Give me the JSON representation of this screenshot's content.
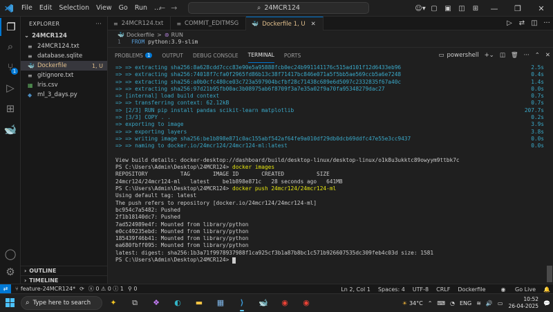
{
  "titlebar": {
    "menus": [
      "File",
      "Edit",
      "Selection",
      "View",
      "Go",
      "Run",
      "..."
    ],
    "search": "24MCR124"
  },
  "explorer": {
    "header": "EXPLORER",
    "folder": "24MCR124",
    "files": [
      {
        "name": "24MCR124.txt",
        "icon": "≡",
        "status": ""
      },
      {
        "name": "database.sqlite",
        "icon": "≡",
        "status": ""
      },
      {
        "name": "Dockerfile",
        "icon": "🐳",
        "status": "1, U"
      },
      {
        "name": "gitignore.txt",
        "icon": "≡",
        "status": ""
      },
      {
        "name": "Iris.csv",
        "icon": "▦",
        "status": ""
      },
      {
        "name": "ml_3_days.py",
        "icon": "◆",
        "status": ""
      }
    ],
    "outline": "OUTLINE",
    "timeline": "TIMELINE"
  },
  "tabs": [
    {
      "label": "24MCR124.txt",
      "icon": "≡"
    },
    {
      "label": "COMMIT_EDITMSG",
      "icon": "≡"
    },
    {
      "label": "Dockerfile 1, U",
      "icon": "🐳"
    }
  ],
  "breadcrumb": {
    "file": "Dockerfile",
    "sep": ">",
    "symbol": "RUN"
  },
  "code": {
    "line_no": "1",
    "keyword": "FROM",
    "text": "python:3.9-slim"
  },
  "panel": {
    "tabs": [
      "PROBLEMS",
      "OUTPUT",
      "DEBUG CONSOLE",
      "TERMINAL",
      "PORTS"
    ],
    "problems_count": "1",
    "shell": "powershell"
  },
  "terminal": {
    "lines": [
      {
        "text": "=> => extracting sha256:8a628cdd7ccc83e90e5a95888fcb0ec24b991141176c515ad101f12d6433eb96",
        "time": "2.5s",
        "blue": true
      },
      {
        "text": "=> => extracting sha256:74018f7cfa0f2965fd86b13c38f71417bc846e071a5f5bb5ae569ccb5a6e7248",
        "time": "0.4s",
        "blue": true
      },
      {
        "text": "=> => extracting sha256:a0b0cfc480ce03c723a597904bcfbf28c71438c689e6d5097c2332835f67a40c",
        "time": "1.4s",
        "blue": true
      },
      {
        "text": "=> => extracting sha256:97d21b95fb00ac3b08975ab6f8709f3a7e35a02f9a70fa95348279dac27",
        "time": "0.0s",
        "blue": true
      },
      {
        "text": "=> [internal] load build context",
        "time": "0.7s",
        "blue": true
      },
      {
        "text": "=> => transferring context: 62.12kB",
        "time": "0.7s",
        "blue": true
      },
      {
        "text": "=> [2/3] RUN pip install pandas scikit-learn matplotlib",
        "time": "207.7s",
        "blue": true
      },
      {
        "text": "=> [3/3] COPY . .",
        "time": "0.2s",
        "blue": true
      },
      {
        "text": "=> exporting to image",
        "time": "3.9s",
        "blue": true
      },
      {
        "text": "=> => exporting layers",
        "time": "3.8s",
        "blue": true
      },
      {
        "text": "=> => writing image sha256:be1b898e871c0ac155abf542af64fe9a010df29db0dcb69ddfc47e55e3cc9437",
        "time": "0.0s",
        "blue": true
      },
      {
        "text": "=> => naming to docker.io/24mcr124/24mcr124-ml:latest",
        "time": "0.0s",
        "blue": true
      },
      {
        "text": "",
        "time": "",
        "blue": false
      },
      {
        "text": "View build details: docker-desktop://dashboard/build/desktop-linux/desktop-linux/o1k8u3ukktc89owyym9ttbk7c",
        "time": "",
        "blue": false
      },
      {
        "text": "PS C:\\Users\\Admin\\Desktop\\24MCR124> ",
        "cmd": "docker images",
        "time": "",
        "blue": false
      },
      {
        "text": "REPOSITORY          TAG       IMAGE ID       CREATED          SIZE",
        "time": "",
        "blue": false
      },
      {
        "text": "24mcr124/24mcr124-ml   latest    be1b898e871c   28 seconds ago   641MB",
        "time": "",
        "blue": false
      },
      {
        "text": "PS C:\\Users\\Admin\\Desktop\\24MCR124> ",
        "cmd": "docker push 24mcr124/24mcr124-ml",
        "time": "",
        "blue": false
      },
      {
        "text": "Using default tag: latest",
        "time": "",
        "blue": false
      },
      {
        "text": "The push refers to repository [docker.io/24mcr124/24mcr124-ml]",
        "time": "",
        "blue": false
      },
      {
        "text": "bc954c7a5482: Pushed",
        "time": "",
        "blue": false
      },
      {
        "text": "2f1b18140dc7: Pushed",
        "time": "",
        "blue": false
      },
      {
        "text": "7ad524989e4f: Mounted from library/python",
        "time": "",
        "blue": false
      },
      {
        "text": "e0cc49235ebd: Mounted from library/python",
        "time": "",
        "blue": false
      },
      {
        "text": "185439f46b41: Mounted from library/python",
        "time": "",
        "blue": false
      },
      {
        "text": "ea680fbff095: Mounted from library/python",
        "time": "",
        "blue": false
      },
      {
        "text": "latest: digest: sha256:1b3a71f9978937988f1ca925cf3b1a87b8bc1c571b926607535dc309feb4c03d size: 1581",
        "time": "",
        "blue": false
      },
      {
        "text": "PS C:\\Users\\Admin\\Desktop\\24MCR124> ",
        "time": "",
        "blue": false,
        "cursor": true
      }
    ]
  },
  "statusbar": {
    "branch": "feature-24MCR124*",
    "errors": "0",
    "warnings": "0",
    "info": "1",
    "position": "Ln 2, Col 1",
    "spaces": "Spaces: 4",
    "encoding": "UTF-8",
    "eol": "CRLF",
    "language": "Dockerfile",
    "golive": "Go Live"
  },
  "taskbar": {
    "search_placeholder": "Type here to search",
    "weather": "34°C",
    "language": "ENG",
    "time": "10:52",
    "date": "26-04-2025"
  },
  "colors": {
    "accent": "#0078d4",
    "terminal_blue": "#3aa9c9",
    "modified": "#e2c08d"
  }
}
